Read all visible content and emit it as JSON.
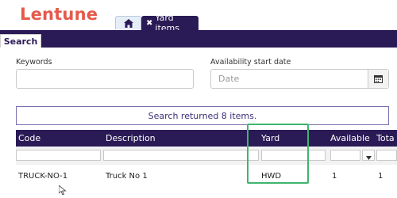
{
  "app": {
    "logo_text": "Lentune"
  },
  "tabs": {
    "home_icon": "home-icon",
    "active_tab": {
      "close_glyph": "✖",
      "label": "Yard items"
    }
  },
  "subtabs": {
    "search_label": "Search"
  },
  "form": {
    "keywords_label": "Keywords",
    "keywords_value": "",
    "availability_label": "Availability start date",
    "date_placeholder": "Date",
    "calendar_icon": "calendar-icon"
  },
  "result_message": "Search returned 8 items.",
  "table": {
    "columns": [
      "Code",
      "Description",
      "Yard",
      "Available",
      "Tota"
    ],
    "rows": [
      {
        "code": "TRUCK-NO-1",
        "description": "Truck No 1",
        "yard": "HWD",
        "available": "1",
        "total": "1"
      }
    ]
  },
  "colors": {
    "brand": "#e45a4c",
    "header": "#2a1b56",
    "highlight": "#3fb46d"
  }
}
